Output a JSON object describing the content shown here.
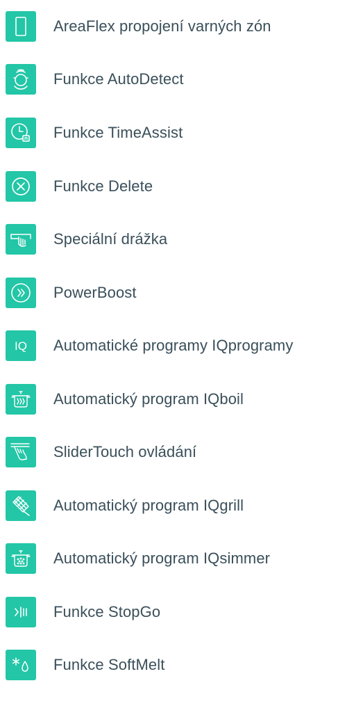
{
  "features": [
    {
      "label": "AreaFlex propojení varných zón",
      "icon": "areaflex-icon"
    },
    {
      "label": "Funkce AutoDetect",
      "icon": "autodetect-icon"
    },
    {
      "label": "Funkce TimeAssist",
      "icon": "timeassist-icon"
    },
    {
      "label": "Funkce Delete",
      "icon": "delete-icon"
    },
    {
      "label": "Speciální drážka",
      "icon": "special-groove-icon"
    },
    {
      "label": "PowerBoost",
      "icon": "powerboost-icon"
    },
    {
      "label": "Automatické programy IQprogramy",
      "icon": "iq-programs-icon"
    },
    {
      "label": "Automatický program IQboil",
      "icon": "iqboil-icon"
    },
    {
      "label": "SliderTouch ovládání",
      "icon": "slidertouch-icon"
    },
    {
      "label": "Automatický program IQgrill",
      "icon": "iqgrill-icon"
    },
    {
      "label": "Automatický program IQsimmer",
      "icon": "iqsimmer-icon"
    },
    {
      "label": "Funkce StopGo",
      "icon": "stopgo-icon"
    },
    {
      "label": "Funkce SoftMelt",
      "icon": "softmelt-icon"
    }
  ],
  "colors": {
    "accent": "#23c6a6",
    "text": "#3a4f5a",
    "background": "#ffffff"
  },
  "icon_glyphs": {
    "iq": "IQ"
  }
}
